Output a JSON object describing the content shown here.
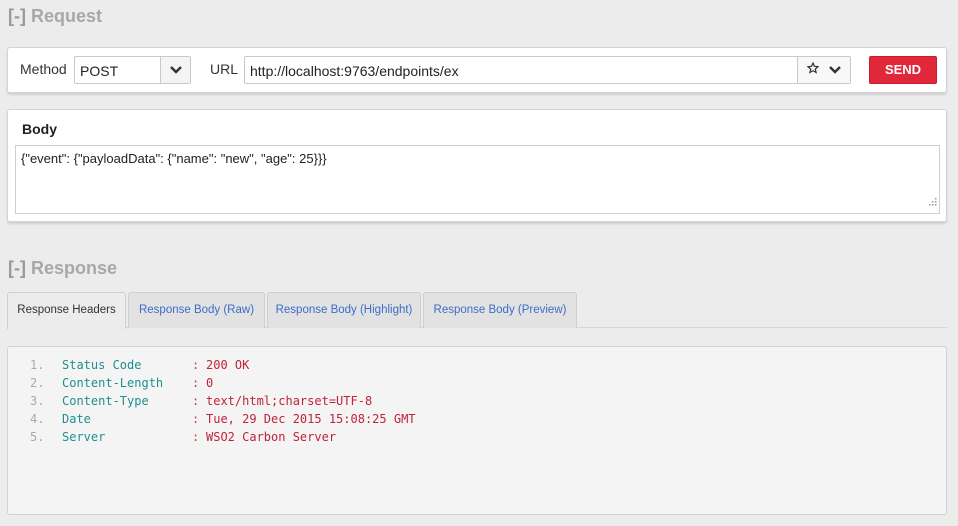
{
  "request": {
    "toggle": "[-]",
    "title": "Request",
    "method_label": "Method",
    "method_value": "POST",
    "url_label": "URL",
    "url_value": "http://localhost:9763/endpoints/ex",
    "send_label": "SEND"
  },
  "body": {
    "label": "Body",
    "content": "{\"event\": {\"payloadData\": {\"name\": \"new\", \"age\": 25}}}"
  },
  "response": {
    "toggle": "[-]",
    "title": "Response",
    "tabs": [
      {
        "label": "Response Headers"
      },
      {
        "label": "Response Body (Raw)"
      },
      {
        "label": "Response Body (Highlight)"
      },
      {
        "label": "Response Body (Preview)"
      }
    ],
    "headers": [
      {
        "num": "1.",
        "key": "Status Code",
        "sep": ":",
        "value": "200 OK"
      },
      {
        "num": "2.",
        "key": "Content-Length",
        "sep": ":",
        "value": "0"
      },
      {
        "num": "3.",
        "key": "Content-Type",
        "sep": ":",
        "value": "text/html;charset=UTF-8"
      },
      {
        "num": "4.",
        "key": "Date",
        "sep": ":",
        "value": "Tue, 29 Dec 2015 15:08:25 GMT"
      },
      {
        "num": "5.",
        "key": "Server",
        "sep": ":",
        "value": "WSO2 Carbon Server"
      }
    ]
  },
  "icons": {
    "method_dropdown": "chevron-down-icon",
    "favorite": "star-icon",
    "url_dropdown": "chevron-down-icon",
    "resize": "resize-grip-icon"
  },
  "colors": {
    "send_button": "#e0283a",
    "tab_link": "#3a6dc9",
    "header_key": "#1f8f8f",
    "header_value": "#c0223b"
  }
}
